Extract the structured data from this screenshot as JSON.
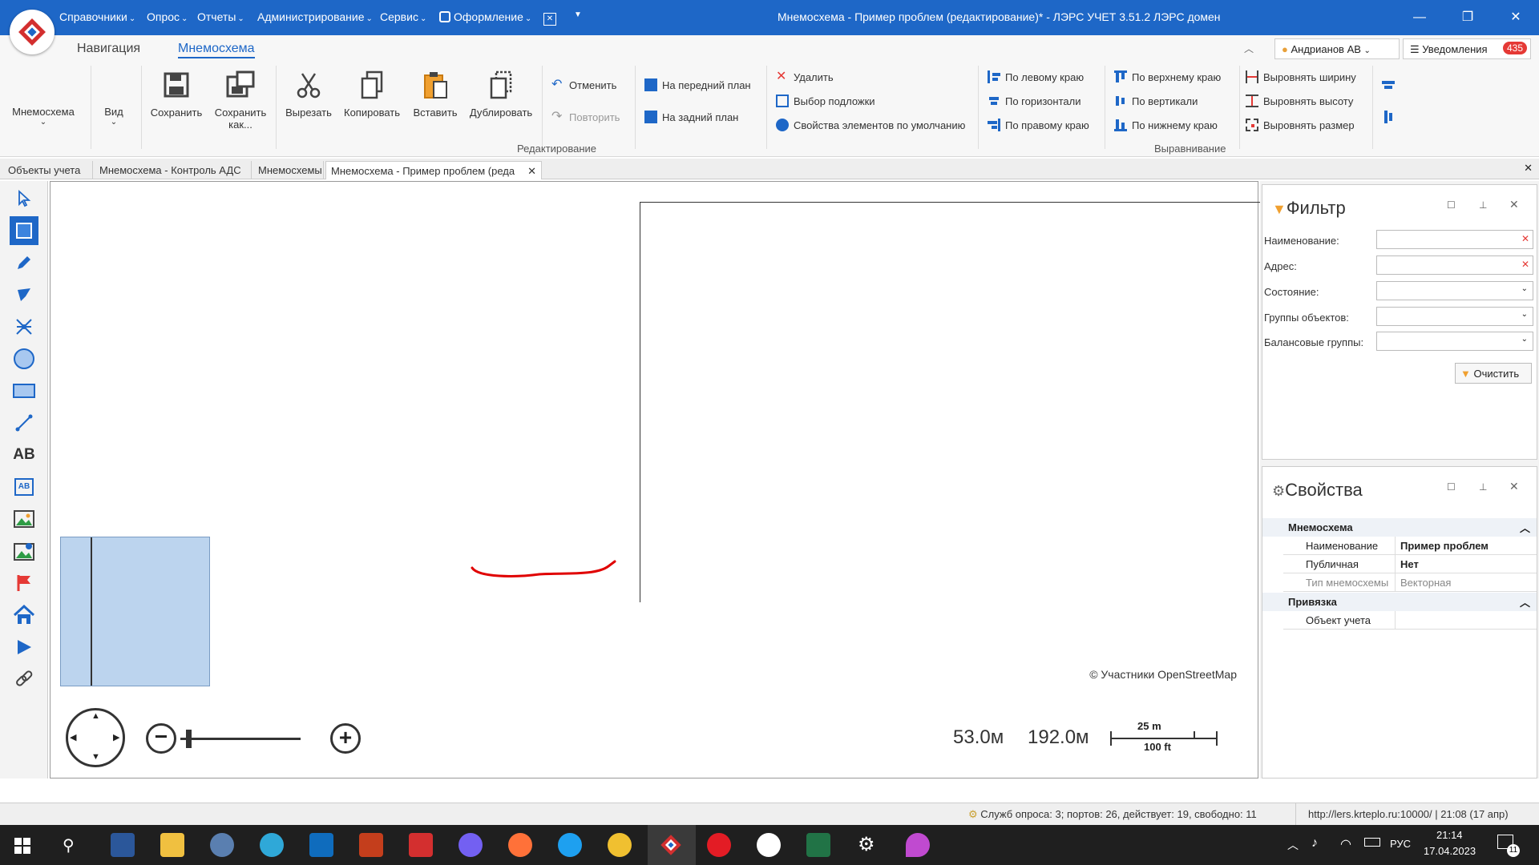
{
  "titlebar": {
    "menus": [
      "Справочники",
      "Опрос",
      "Отчеты",
      "Администрирование",
      "Сервис",
      "Оформление"
    ],
    "title": "Мнемосхема - Пример проблем (редактирование)* - ЛЭРС УЧЕТ 3.51.2 ЛЭРС домен",
    "minimize": "—",
    "restore": "❐",
    "close": "✕"
  },
  "ribbon_tabs": {
    "nav": "Навигация",
    "mnemo": "Мнемосхема",
    "user": "Андрианов АВ",
    "notifications": "Уведомления",
    "notifications_count": "435"
  },
  "ribbon": {
    "mnemo_label": "Мнемосхема",
    "view_label": "Вид",
    "save": "Сохранить",
    "save_as_1": "Сохранить",
    "save_as_2": "как...",
    "cut": "Вырезать",
    "copy": "Копировать",
    "paste": "Вставить",
    "duplicate": "Дублировать",
    "undo": "Отменить",
    "redo": "Повторить",
    "front": "На передний план",
    "back": "На задний план",
    "delete": "Удалить",
    "substrate": "Выбор подложки",
    "default_props": "Свойства элементов по умолчанию",
    "edit_group": "Редактирование",
    "align_left": "По левому краю",
    "align_hcenter": "По горизонтали",
    "align_right": "По правому краю",
    "align_top": "По верхнему краю",
    "align_vcenter": "По вертикали",
    "align_bottom": "По нижнему краю",
    "same_width": "Выровнять ширину",
    "same_height": "Выровнять высоту",
    "same_size": "Выровнять размер",
    "align_group": "Выравнивание"
  },
  "doc_tabs": [
    "Объекты учета",
    "Мнемосхема - Контроль АДС",
    "Мнемосхемы",
    "Мнемосхема - Пример проблем (реда"
  ],
  "canvas": {
    "attribution": "© Участники OpenStreetMap",
    "coord_x": "53.0м",
    "coord_y": "192.0м",
    "scale_m": "25 m",
    "scale_ft": "100 ft",
    "zoom_level": 0.05
  },
  "filter": {
    "title": "Фильтр",
    "name_label": "Наименование:",
    "address_label": "Адрес:",
    "state_label": "Состояние:",
    "groups_label": "Группы объектов:",
    "balance_label": "Балансовые группы:",
    "clear": "Очистить"
  },
  "properties": {
    "title": "Свойства",
    "section1": "Мнемосхема",
    "rows": [
      {
        "k": "Наименование",
        "v": "Пример проблем"
      },
      {
        "k": "Публичная",
        "v": "Нет"
      },
      {
        "k": "Тип мнемосхемы",
        "v": "Векторная"
      }
    ],
    "section2": "Привязка",
    "link_row": "Объект учета"
  },
  "status": {
    "services": "Служб опроса: 3; портов: 26, действует: 19, свободно: 11",
    "server": "http://lers.krteplo.ru:10000/ | 21:08 (17 апр)"
  },
  "taskbar": {
    "lang": "РУС",
    "time": "21:14",
    "date": "17.04.2023",
    "notif": "11"
  },
  "colors": {
    "accent": "#1e67c7",
    "shape_fill": "#bcd4ee",
    "annotation": "#e00000",
    "badge": "#e53935"
  }
}
